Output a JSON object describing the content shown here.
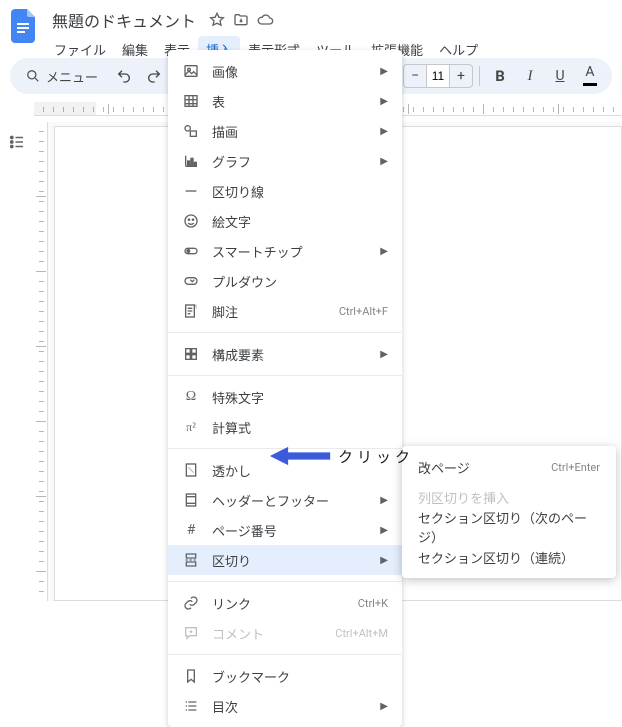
{
  "title": "無題のドキュメント",
  "menubar": [
    "ファイル",
    "編集",
    "表示",
    "挿入",
    "表示形式",
    "ツール",
    "拡張機能",
    "ヘルプ"
  ],
  "menubar_active": 3,
  "toolbar": {
    "menu_label": "メニュー",
    "font_size": "11"
  },
  "dropdown": {
    "groups": [
      [
        {
          "icon": "image",
          "label": "画像",
          "arrow": true
        },
        {
          "icon": "table",
          "label": "表",
          "arrow": true
        },
        {
          "icon": "drawing",
          "label": "描画",
          "arrow": true
        },
        {
          "icon": "chart",
          "label": "グラフ",
          "arrow": true
        },
        {
          "icon": "hr",
          "label": "区切り線"
        },
        {
          "icon": "emoji",
          "label": "絵文字"
        },
        {
          "icon": "smartchip",
          "label": "スマートチップ",
          "arrow": true
        },
        {
          "icon": "pulldown",
          "label": "プルダウン"
        },
        {
          "icon": "footnote",
          "label": "脚注",
          "shortcut": "Ctrl+Alt+F"
        }
      ],
      [
        {
          "icon": "blocks",
          "label": "構成要素",
          "arrow": true
        }
      ],
      [
        {
          "icon": "omega",
          "label": "特殊文字"
        },
        {
          "icon": "pi",
          "label": "計算式"
        }
      ],
      [
        {
          "icon": "watermark",
          "label": "透かし"
        },
        {
          "icon": "headerfooter",
          "label": "ヘッダーとフッター",
          "arrow": true
        },
        {
          "icon": "hash",
          "label": "ページ番号",
          "arrow": true
        },
        {
          "icon": "pagebreak",
          "label": "区切り",
          "arrow": true,
          "active": true
        }
      ],
      [
        {
          "icon": "link",
          "label": "リンク",
          "shortcut": "Ctrl+K"
        },
        {
          "icon": "comment",
          "label": "コメント",
          "shortcut": "Ctrl+Alt+M",
          "disabled": true
        }
      ],
      [
        {
          "icon": "bookmark",
          "label": "ブックマーク"
        },
        {
          "icon": "toc",
          "label": "目次",
          "arrow": true
        }
      ]
    ]
  },
  "submenu": [
    {
      "label": "改ページ",
      "shortcut": "Ctrl+Enter"
    },
    {
      "label": "列区切りを挿入",
      "disabled": true
    },
    {
      "label": "セクション区切り（次のページ）"
    },
    {
      "label": "セクション区切り（連続）"
    }
  ],
  "annotation": {
    "label": "クリック"
  }
}
